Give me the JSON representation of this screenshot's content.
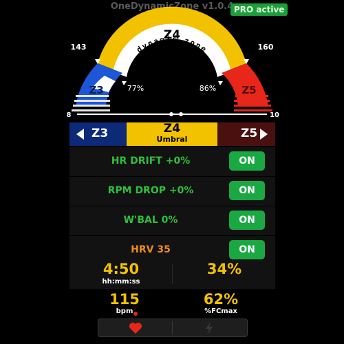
{
  "app": {
    "title": "OneDynamicZone v1.0.4",
    "badge": "PRO active"
  },
  "gauge": {
    "zone_label": "Z4",
    "arc_text": "dynamic zone",
    "zone_name": "Umbral",
    "left_value": "143",
    "right_value": "160",
    "left_zone": "Z3",
    "right_zone": "Z5",
    "left_pct": "77%",
    "right_pct": "86%",
    "edge_left": "8",
    "edge_right": "10",
    "colors": {
      "z3": "#1e56d8",
      "z4": "#f2c200",
      "z5": "#e8261a",
      "arc_inner": "#ffffff"
    }
  },
  "zone_bar": {
    "prev": "Z3",
    "current": "Z4",
    "current_name": "Umbral",
    "next": "Z5"
  },
  "toggles": [
    {
      "label": "HR DRIFT  +0%",
      "state": "ON",
      "color": "green"
    },
    {
      "label": "RPM DROP  +0%",
      "state": "ON",
      "color": "green"
    },
    {
      "label": "W'BAL  0%",
      "state": "ON",
      "color": "green"
    },
    {
      "label": "HRV  35",
      "state": "ON",
      "color": "orange"
    }
  ],
  "stats": {
    "time": "4:50",
    "time_unit": "hh:mm:ss",
    "percent": "34%",
    "hr": "115",
    "hr_unit": "bpm",
    "fcmax": "62%",
    "fcmax_unit": "%FCmax"
  },
  "bottom_bar": {
    "left_icon": "heart-icon",
    "right_icon": "lightning-icon"
  }
}
